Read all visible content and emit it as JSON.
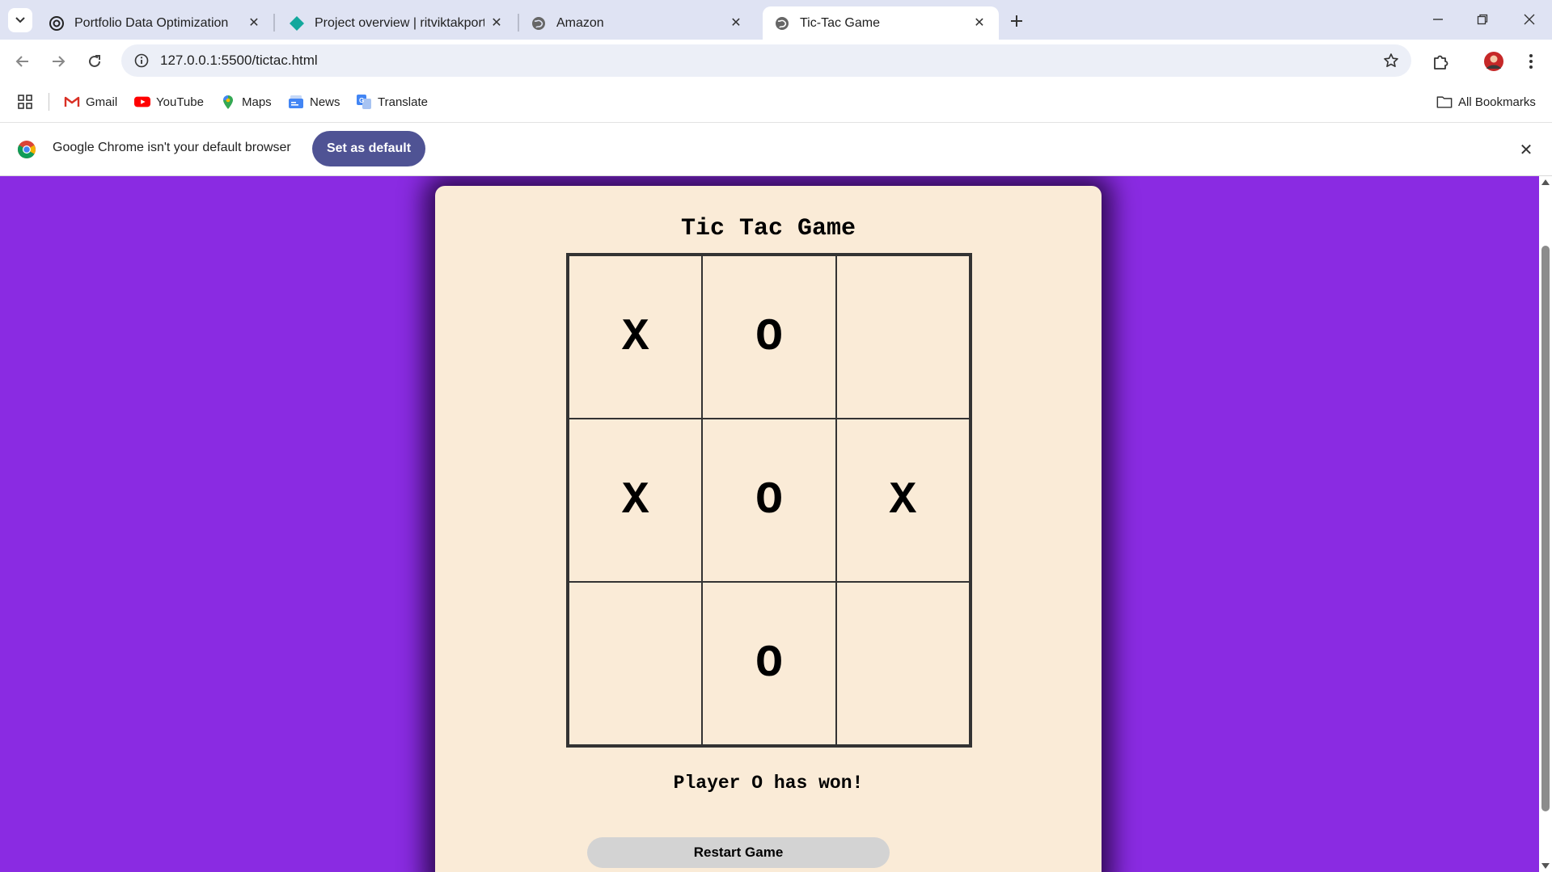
{
  "browser": {
    "tabs": [
      {
        "title": "Portfolio Data Optimization",
        "icon": "openai-icon",
        "active": false
      },
      {
        "title": "Project overview | ritviktakportf",
        "icon": "diamond-icon",
        "active": false
      },
      {
        "title": "Amazon",
        "icon": "globe-icon",
        "active": false
      },
      {
        "title": "Tic-Tac Game",
        "icon": "globe-icon",
        "active": true
      }
    ],
    "address": "127.0.0.1:5500/tictac.html",
    "bookmarks": [
      {
        "label": "Gmail",
        "icon": "gmail-icon"
      },
      {
        "label": "YouTube",
        "icon": "youtube-icon"
      },
      {
        "label": "Maps",
        "icon": "maps-icon"
      },
      {
        "label": "News",
        "icon": "news-icon"
      },
      {
        "label": "Translate",
        "icon": "translate-icon"
      }
    ],
    "all_bookmarks_label": "All Bookmarks",
    "infobar": {
      "message": "Google Chrome isn't your default browser",
      "button_label": "Set as default"
    }
  },
  "game": {
    "title": "Tic Tac Game",
    "board": [
      "X",
      "O",
      "",
      "X",
      "O",
      "X",
      "",
      "O",
      ""
    ],
    "status": "Player O has won!",
    "restart_label": "Restart Game"
  },
  "colors": {
    "page_background": "#8a2be2",
    "card_background": "#faebd7",
    "button_background": "#d3d3d3",
    "infobar_button": "#4f5394"
  }
}
